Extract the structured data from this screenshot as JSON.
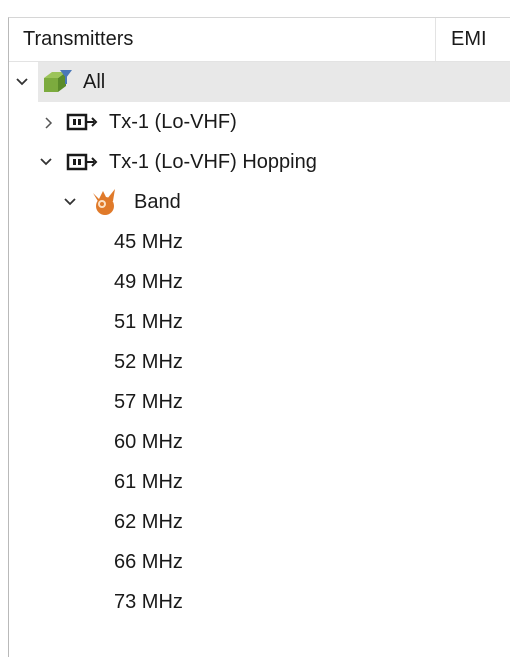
{
  "columns": {
    "transmitters": "Transmitters",
    "emi": "EMI"
  },
  "tree": {
    "all": {
      "label": "All"
    },
    "tx1": {
      "label": "Tx-1 (Lo-VHF)"
    },
    "tx1_hopping": {
      "label": "Tx-1 (Lo-VHF) Hopping"
    },
    "band": {
      "label": "Band"
    },
    "frequencies": [
      "45 MHz",
      "49 MHz",
      "51 MHz",
      "52 MHz",
      "57 MHz",
      "60 MHz",
      "61 MHz",
      "62 MHz",
      "66 MHz",
      "73 MHz"
    ]
  },
  "colors": {
    "selected_row": "#e8e8e8",
    "all_icon_green": "#7cab3e",
    "all_icon_blue": "#4a78b8",
    "band_icon_orange": "#e07a2a"
  },
  "icons": {
    "expand": "chevron-right-icon",
    "collapse": "chevron-down-icon",
    "all": "transmitter-group-icon",
    "transmitter": "transmitter-icon",
    "band": "band-icon"
  }
}
